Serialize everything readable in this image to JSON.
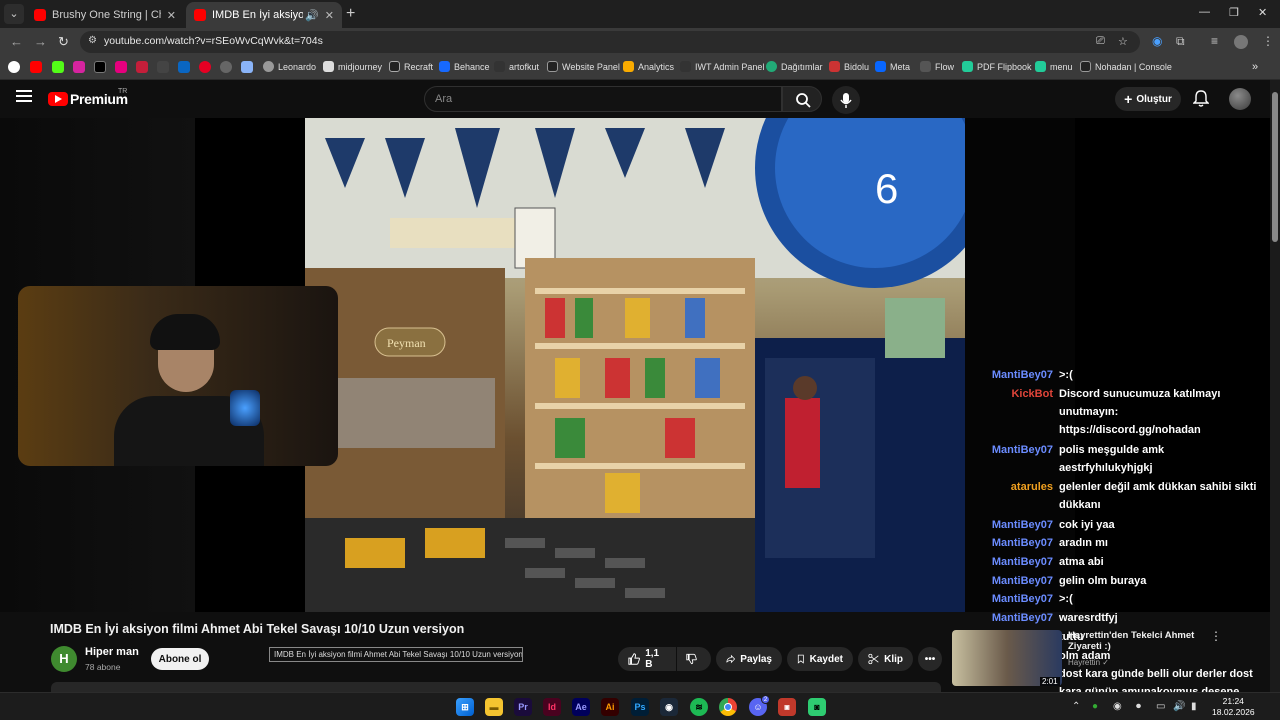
{
  "browser": {
    "tabs": [
      {
        "label": "Brushy One String | Chicken in",
        "active": false
      },
      {
        "label": "IMDB En İyi aksiyon filmi Ah",
        "active": true
      }
    ],
    "url": "youtube.com/watch?v=rSEoWvCqWvk&t=704s",
    "bookmarks": [
      "Leonardo",
      "midjourney",
      "Recraft",
      "Behance",
      "artofkut",
      "Website Panel",
      "Analytics",
      "IWT Admin Panel",
      "Dağıtımlar",
      "Bidolu",
      "Meta",
      "Flow",
      "PDF Flipbook",
      "menu",
      "Nohadan | Console"
    ]
  },
  "youtube": {
    "brand": "Premium",
    "region": "TR",
    "search_placeholder": "Ara",
    "create_label": "Oluştur"
  },
  "video": {
    "title": "IMDB En İyi aksiyon filmi Ahmet Abi Tekel Savaşı 10/10 Uzun versiyon",
    "tooltip": "IMDB En İyi aksiyon filmi Ahmet Abi Tekel Savaşı 10/10 Uzun versiyon",
    "channel": {
      "initial": "H",
      "name": "Hiper man",
      "subs": "78 abone",
      "subscribe_label": "Abone ol"
    },
    "actions": {
      "likes": "1,1 B",
      "share": "Paylaş",
      "save": "Kaydet",
      "clip": "Klip"
    }
  },
  "chat": [
    {
      "user": "MantiBey07",
      "color": "#6b8cff",
      "msg": ">:("
    },
    {
      "user": "KickBot",
      "color": "#e0453a",
      "msg": "Discord sunucumuza katılmayı unutmayın: https://discord.gg/nohadan"
    },
    {
      "user": "MantiBey07",
      "color": "#6b8cff",
      "msg": "polis meşgulde amk aestrfyhılukyhjgkj"
    },
    {
      "user": "atarules",
      "color": "#f0a020",
      "msg": "gelenler değil amk dükkan sahibi sikti dükkanı"
    },
    {
      "user": "MantiBey07",
      "color": "#6b8cff",
      "msg": "cok iyi yaa"
    },
    {
      "user": "MantiBey07",
      "color": "#6b8cff",
      "msg": "aradın mı"
    },
    {
      "user": "MantiBey07",
      "color": "#6b8cff",
      "msg": "atma abi"
    },
    {
      "user": "MantiBey07",
      "color": "#6b8cff",
      "msg": "gelin olm buraya"
    },
    {
      "user": "MantiBey07",
      "color": "#6b8cff",
      "msg": ">:("
    },
    {
      "user": "MantiBey07",
      "color": "#6b8cff",
      "msg": "waresrdtfyj"
    },
    {
      "user": "MantiBey07",
      "color": "#6b8cff",
      "msg": "tuttu"
    },
    {
      "user": "MantiBey07",
      "color": "#6b8cff",
      "msg": "olm adam"
    },
    {
      "user": "atarules",
      "color": "#f0a020",
      "msg": "dost kara günde belli olur derler dost kara günün amunakoymus desene"
    }
  ],
  "recommendation": {
    "title": "Hayrettin'den Tekelci Ahmet Ziyareti :)",
    "channel": "Hayrettin",
    "duration": "2:01"
  },
  "taskbar": {
    "time": "21:24",
    "date": "18.02.2026",
    "discord_badge": "2"
  },
  "colors": {
    "youtube_red": "#ff0000",
    "chat_blue": "#6b8cff",
    "chat_red": "#e0453a",
    "chat_orange": "#f0a020"
  }
}
